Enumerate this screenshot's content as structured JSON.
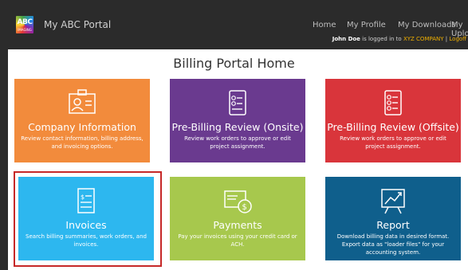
{
  "app": {
    "logo_text": "ABC",
    "logo_sub": "IMAGING",
    "title": "My ABC Portal"
  },
  "nav": {
    "home": "Home",
    "profile": "My Profile",
    "downloads": "My Downloads",
    "uploads": "My Uploads"
  },
  "user": {
    "name": "John Doe",
    "logged_text": "is logged in to",
    "company": "XYZ COMPANY",
    "separator": "|",
    "logoff": "Logoff"
  },
  "page": {
    "title": "Billing Portal Home"
  },
  "tiles": [
    {
      "title": "Company Information",
      "desc": "Review contact information, billing address, and invoicing options.",
      "icon": "contact-card-icon",
      "color": "#f28b3c"
    },
    {
      "title": "Pre-Billing Review (Onsite)",
      "desc": "Review work orders to approve or edit project assignment.",
      "icon": "checklist-icon",
      "color": "#6a3a8f"
    },
    {
      "title": "Pre-Billing Review (Offsite)",
      "desc": "Review work orders to approve or edit project assignment.",
      "icon": "checklist-icon",
      "color": "#d9353b"
    },
    {
      "title": "Invoices",
      "desc": "Search billing summaries, work orders, and invoices.",
      "icon": "invoice-icon",
      "color": "#2db7ef"
    },
    {
      "title": "Payments",
      "desc": "Pay your invoices using your credit card or ACH.",
      "icon": "payment-card-icon",
      "color": "#a7c84d"
    },
    {
      "title": "Report",
      "desc": "Download billing data in desired format. Export data as \"loader files\" for your accounting system.",
      "icon": "report-chart-icon",
      "color": "#0f5f8c"
    }
  ],
  "colors": {
    "header_bg": "#2b2b2b",
    "accent": "#f0b000",
    "selection": "#c62828"
  }
}
